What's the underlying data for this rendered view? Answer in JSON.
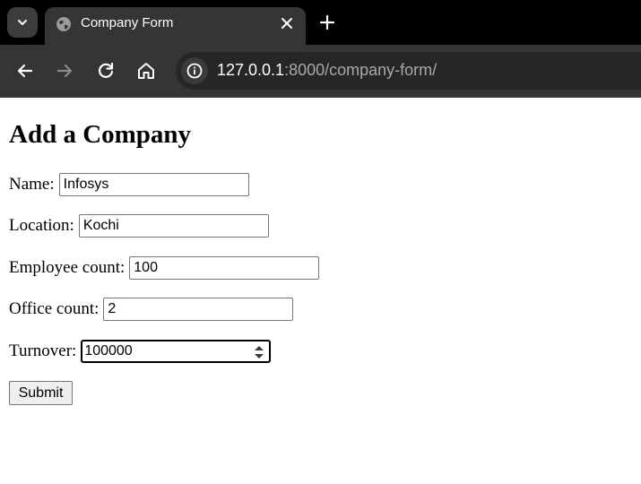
{
  "browser": {
    "tab": {
      "title": "Company Form"
    },
    "url": {
      "host": "127.0.0.1",
      "rest": ":8000/company-form/"
    }
  },
  "page": {
    "title": "Add a Company",
    "fields": [
      {
        "label": "Name:",
        "value": "Infosys"
      },
      {
        "label": "Location:",
        "value": "Kochi"
      },
      {
        "label": "Employee count:",
        "value": "100"
      },
      {
        "label": "Office count:",
        "value": "2"
      },
      {
        "label": "Turnover:",
        "value": "100000"
      }
    ],
    "submit_label": "Submit"
  },
  "colors": {
    "chrome_dark": "#000000",
    "toolbar": "#353535",
    "omnibox": "#262626"
  }
}
